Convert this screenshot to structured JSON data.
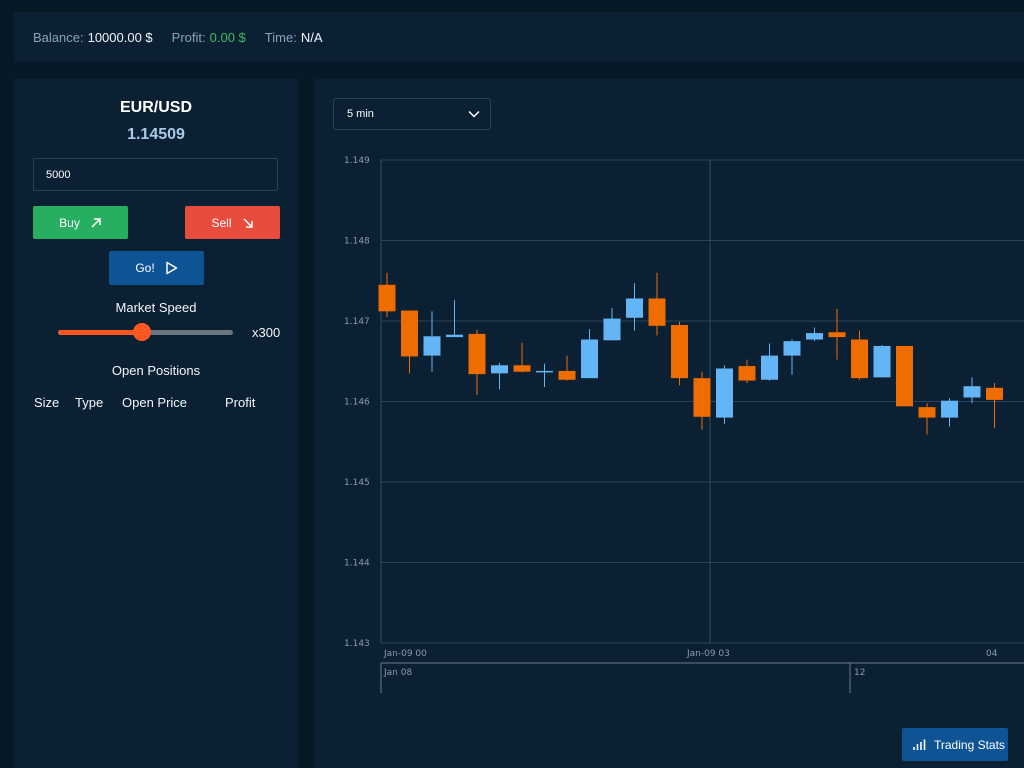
{
  "topbar": {
    "balance_label": "Balance:",
    "balance_value": "10000.00 $",
    "profit_label": "Profit:",
    "profit_value": "0.00 $",
    "time_label": "Time:",
    "time_value": "N/A",
    "profit_color": "#3dbb63"
  },
  "trade_panel": {
    "pair": "EUR/USD",
    "price": "1.14509",
    "amount_value": "5000",
    "buy_label": "Buy",
    "sell_label": "Sell",
    "go_label": "Go!",
    "speed_label": "Market Speed",
    "speed_value": "x300",
    "speed_fraction": 0.48,
    "open_positions_label": "Open Positions",
    "columns": [
      "Size",
      "Type",
      "Open Price",
      "Profit"
    ],
    "colors": {
      "buy": "#27ae60",
      "sell": "#e74c3c",
      "go": "#0e5394",
      "slider": "#ff5722"
    }
  },
  "chart_panel": {
    "timeframe_selected": "5 min",
    "stats_button_label": "Trading Stats"
  },
  "chart_data": {
    "type": "candlestick",
    "ylim": [
      1.143,
      1.149
    ],
    "yticks": [
      "1.149",
      "1.148",
      "1.147",
      "1.146",
      "1.145",
      "1.144",
      "1.143"
    ],
    "xticks": [
      "Jan-09 00",
      "Jan-09 03",
      "04"
    ],
    "navigator_ticks": [
      "Jan 08",
      "12"
    ],
    "up_color": "#64b5f6",
    "down_color": "#ef6c00",
    "candles": [
      {
        "o": 1.14745,
        "h": 1.1476,
        "l": 1.14705,
        "c": 1.14712
      },
      {
        "o": 1.14713,
        "h": 1.14713,
        "l": 1.14635,
        "c": 1.14656
      },
      {
        "o": 1.14657,
        "h": 1.14712,
        "l": 1.14637,
        "c": 1.14681
      },
      {
        "o": 1.1468,
        "h": 1.14726,
        "l": 1.1468,
        "c": 1.14683
      },
      {
        "o": 1.14684,
        "h": 1.14689,
        "l": 1.14608,
        "c": 1.14634
      },
      {
        "o": 1.14635,
        "h": 1.14648,
        "l": 1.14615,
        "c": 1.14645
      },
      {
        "o": 1.14645,
        "h": 1.14673,
        "l": 1.14636,
        "c": 1.14637
      },
      {
        "o": 1.14637,
        "h": 1.14647,
        "l": 1.14618,
        "c": 1.14638
      },
      {
        "o": 1.14638,
        "h": 1.14657,
        "l": 1.14626,
        "c": 1.14627
      },
      {
        "o": 1.14629,
        "h": 1.1469,
        "l": 1.14629,
        "c": 1.14677
      },
      {
        "o": 1.14676,
        "h": 1.14716,
        "l": 1.14676,
        "c": 1.14703
      },
      {
        "o": 1.14704,
        "h": 1.14747,
        "l": 1.14688,
        "c": 1.14728
      },
      {
        "o": 1.14728,
        "h": 1.1476,
        "l": 1.14682,
        "c": 1.14694
      },
      {
        "o": 1.14695,
        "h": 1.14699,
        "l": 1.1462,
        "c": 1.14629
      },
      {
        "o": 1.14629,
        "h": 1.14637,
        "l": 1.14565,
        "c": 1.14581
      },
      {
        "o": 1.1458,
        "h": 1.14645,
        "l": 1.14572,
        "c": 1.14641
      },
      {
        "o": 1.14644,
        "h": 1.14652,
        "l": 1.14623,
        "c": 1.14626
      },
      {
        "o": 1.14627,
        "h": 1.14672,
        "l": 1.14626,
        "c": 1.14657
      },
      {
        "o": 1.14657,
        "h": 1.14677,
        "l": 1.14633,
        "c": 1.14675
      },
      {
        "o": 1.14677,
        "h": 1.14692,
        "l": 1.14675,
        "c": 1.14685
      },
      {
        "o": 1.14686,
        "h": 1.14715,
        "l": 1.14652,
        "c": 1.1468
      },
      {
        "o": 1.14677,
        "h": 1.14688,
        "l": 1.14627,
        "c": 1.14629
      },
      {
        "o": 1.1463,
        "h": 1.1467,
        "l": 1.1463,
        "c": 1.14669
      },
      {
        "o": 1.14669,
        "h": 1.14669,
        "l": 1.14594,
        "c": 1.14594
      },
      {
        "o": 1.14593,
        "h": 1.14598,
        "l": 1.14559,
        "c": 1.1458
      },
      {
        "o": 1.1458,
        "h": 1.14604,
        "l": 1.14569,
        "c": 1.14601
      },
      {
        "o": 1.14605,
        "h": 1.1463,
        "l": 1.14598,
        "c": 1.14619
      },
      {
        "o": 1.14617,
        "h": 1.14623,
        "l": 1.14567,
        "c": 1.14602
      }
    ]
  }
}
